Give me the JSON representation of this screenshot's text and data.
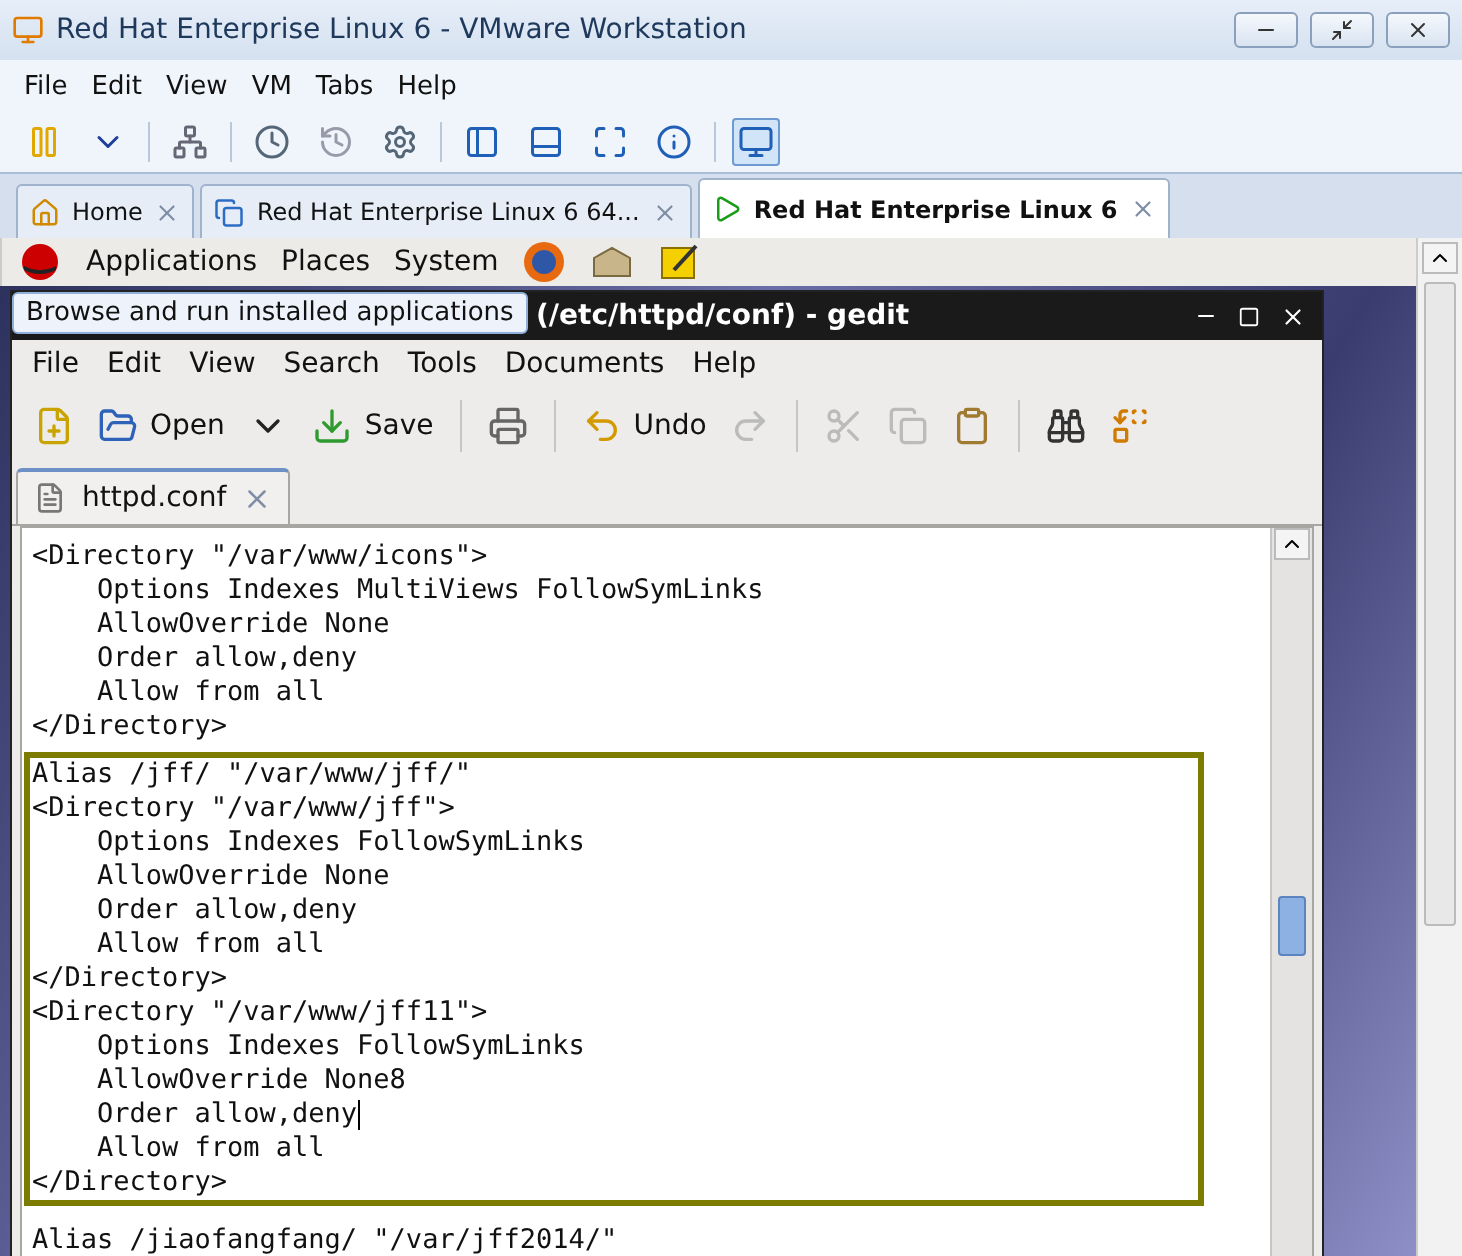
{
  "window": {
    "title": "Red Hat Enterprise Linux 6 - VMware Workstation"
  },
  "menu": [
    "File",
    "Edit",
    "View",
    "VM",
    "Tabs",
    "Help"
  ],
  "toolbar": [
    {
      "kind": "pause",
      "selected": false
    },
    {
      "kind": "caret",
      "selected": false
    },
    {
      "kind": "sep"
    },
    {
      "kind": "network",
      "selected": false
    },
    {
      "kind": "sep"
    },
    {
      "kind": "snapshot",
      "selected": false
    },
    {
      "kind": "revert",
      "selected": false
    },
    {
      "kind": "manage",
      "selected": false
    },
    {
      "kind": "sep"
    },
    {
      "kind": "console",
      "selected": false
    },
    {
      "kind": "fullscreen",
      "selected": false
    },
    {
      "kind": "fit",
      "selected": false
    },
    {
      "kind": "info",
      "selected": false
    },
    {
      "kind": "sep"
    },
    {
      "kind": "unity",
      "selected": true
    }
  ],
  "tabs": [
    {
      "label": "Home",
      "kind": "home",
      "selected": false
    },
    {
      "label": "Red Hat Enterprise Linux 6 64...",
      "kind": "vm",
      "selected": false
    },
    {
      "label": "Red Hat Enterprise Linux 6",
      "kind": "vm-running",
      "selected": true
    }
  ],
  "guest_panel": {
    "menus": [
      "Applications",
      "Places",
      "System"
    ],
    "tooltip": "Browse and run installed applications"
  },
  "gedit": {
    "title": "(/etc/httpd/conf) - gedit",
    "menu": [
      "File",
      "Edit",
      "View",
      "Search",
      "Tools",
      "Documents",
      "Help"
    ],
    "toolbar": [
      {
        "kind": "new",
        "disabled": false
      },
      {
        "kind": "open",
        "label": "Open",
        "disabled": false
      },
      {
        "kind": "dropdown",
        "disabled": false
      },
      {
        "kind": "save",
        "label": "Save",
        "disabled": false
      },
      {
        "kind": "sep"
      },
      {
        "kind": "print",
        "disabled": false
      },
      {
        "kind": "sep"
      },
      {
        "kind": "undo",
        "label": "Undo",
        "disabled": false
      },
      {
        "kind": "redo",
        "disabled": true
      },
      {
        "kind": "sep"
      },
      {
        "kind": "cut",
        "disabled": true
      },
      {
        "kind": "copy",
        "disabled": true
      },
      {
        "kind": "paste",
        "disabled": false
      },
      {
        "kind": "sep"
      },
      {
        "kind": "find",
        "disabled": false
      },
      {
        "kind": "replace",
        "disabled": false
      }
    ],
    "doc_tab": {
      "label": "httpd.conf"
    },
    "blocks": [
      {
        "kind": "plain",
        "lines": [
          {
            "text": "<Directory \"/var/www/icons\">",
            "cursor": false
          },
          {
            "text": "    Options Indexes MultiViews FollowSymLinks",
            "cursor": false
          },
          {
            "text": "    AllowOverride None",
            "cursor": false
          },
          {
            "text": "    Order allow,deny",
            "cursor": false
          },
          {
            "text": "    Allow from all",
            "cursor": false
          },
          {
            "text": "</Directory>",
            "cursor": false
          }
        ]
      },
      {
        "kind": "highlight",
        "lines": [
          {
            "text": "Alias /jff/ \"/var/www/jff/\"",
            "cursor": false
          },
          {
            "text": "<Directory \"/var/www/jff\">",
            "cursor": false
          },
          {
            "text": "    Options Indexes FollowSymLinks",
            "cursor": false
          },
          {
            "text": "    AllowOverride None",
            "cursor": false
          },
          {
            "text": "    Order allow,deny",
            "cursor": false
          },
          {
            "text": "    Allow from all",
            "cursor": false
          },
          {
            "text": "</Directory>",
            "cursor": false
          },
          {
            "text": "<Directory \"/var/www/jff11\">",
            "cursor": false
          },
          {
            "text": "    Options Indexes FollowSymLinks",
            "cursor": false
          },
          {
            "text": "    AllowOverride None8",
            "cursor": false
          },
          {
            "text": "    Order allow,deny",
            "cursor": true
          },
          {
            "text": "    Allow from all",
            "cursor": false
          },
          {
            "text": "</Directory>",
            "cursor": false
          }
        ]
      },
      {
        "kind": "plain",
        "lines": [
          {
            "text": "Alias /jiaofangfang/ \"/var/jff2014/\"",
            "cursor": false
          }
        ]
      }
    ]
  }
}
